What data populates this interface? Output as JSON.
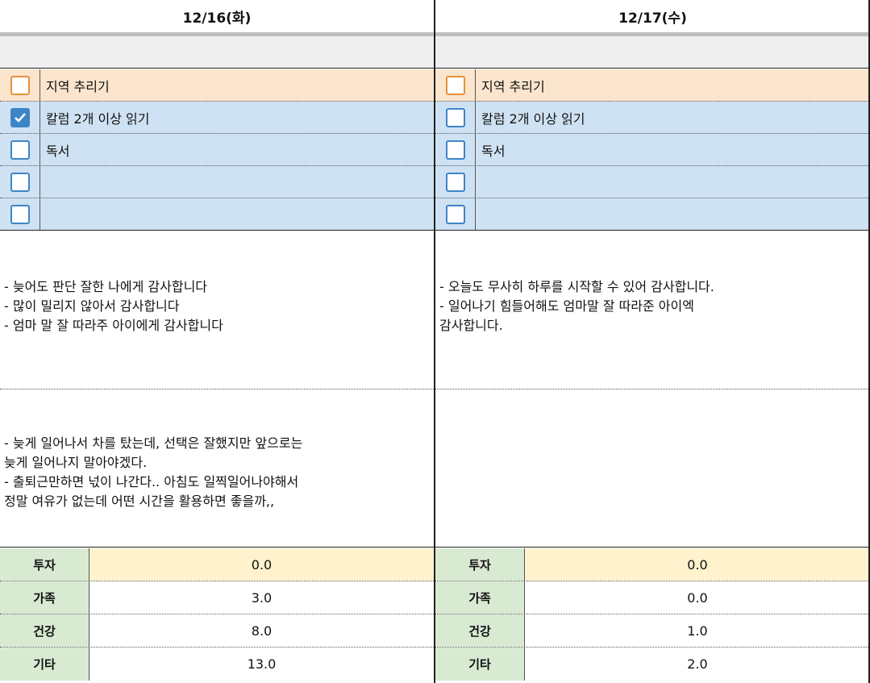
{
  "columns": [
    {
      "date": "12/16(화)",
      "todos": [
        {
          "label": "지역 추리기",
          "checked": false,
          "color": "orange"
        },
        {
          "label": "칼럼 2개 이상 읽기",
          "checked": true,
          "color": "blue"
        },
        {
          "label": "독서",
          "checked": false,
          "color": "blue"
        },
        {
          "label": "",
          "checked": false,
          "color": "blue"
        },
        {
          "label": "",
          "checked": false,
          "color": "blue"
        }
      ],
      "gratitude": [
        "- 늦어도 판단 잘한 나에게 감사합니다",
        "- 많이 밀리지 않아서 감사합니다",
        "- 엄마 말 잘 따라주 아이에게 감사합니다"
      ],
      "reflection": [
        "- 늦게 일어나서 차를 탔는데, 선택은 잘했지만 앞으로는",
        "늦게 일어나지 말아야겠다.",
        "- 출퇴근만하면 넋이 나간다.. 아침도 일찍일어나야해서",
        "정말 여유가 없는데 어떤 시간을 활용하면 좋을까,,"
      ],
      "metrics": [
        {
          "key": "투자",
          "value": "0.0"
        },
        {
          "key": "가족",
          "value": "3.0"
        },
        {
          "key": "건강",
          "value": "8.0"
        },
        {
          "key": "기타",
          "value": "13.0"
        }
      ]
    },
    {
      "date": "12/17(수)",
      "todos": [
        {
          "label": "지역 추리기",
          "checked": false,
          "color": "orange"
        },
        {
          "label": "칼럼 2개 이상 읽기",
          "checked": false,
          "color": "blue"
        },
        {
          "label": "독서",
          "checked": false,
          "color": "blue"
        },
        {
          "label": "",
          "checked": false,
          "color": "blue"
        },
        {
          "label": "",
          "checked": false,
          "color": "blue"
        }
      ],
      "gratitude": [
        "- 오늘도 무사히 하루를 시작할 수 있어 감사합니다.",
        "- 일어나기 힘들어해도 엄마말 잘 따라준 아이엑",
        "감사합니다."
      ],
      "reflection": [],
      "metrics": [
        {
          "key": "투자",
          "value": "0.0"
        },
        {
          "key": "가족",
          "value": "0.0"
        },
        {
          "key": "건강",
          "value": "1.0"
        },
        {
          "key": "기타",
          "value": "2.0"
        }
      ]
    }
  ],
  "colors": {
    "orange_row": "#fce5cd",
    "blue_row": "#cfe2f3",
    "checkbox_blue": "#3d85c6",
    "checkbox_orange": "#e69138",
    "metric_key_bg": "#d9ead3",
    "metric_highlight": "#fff2cc"
  }
}
